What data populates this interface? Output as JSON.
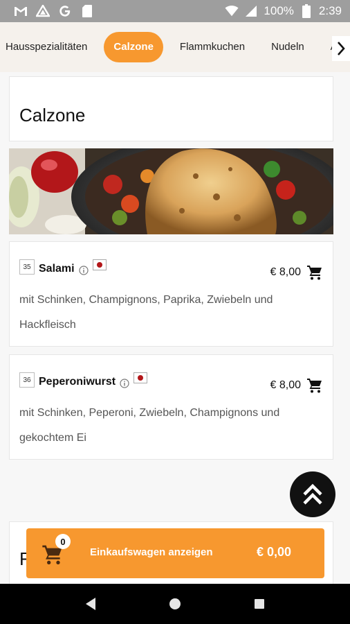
{
  "status_bar": {
    "battery": "100%",
    "time": "2:39"
  },
  "categories": {
    "items": [
      "Hausspezialitäten",
      "Calzone",
      "Flammkuchen",
      "Nudeln",
      "Al Forno"
    ],
    "active": "Calzone"
  },
  "section": {
    "title": "Calzone",
    "next_title_partial": "F"
  },
  "menu_items": [
    {
      "number": "35",
      "name": "Salami",
      "price": "€ 8,00",
      "description": "mit Schinken, Champignons, Paprika, Zwiebeln und Hackfleisch"
    },
    {
      "number": "36",
      "name": "Peperoniwurst",
      "price": "€ 8,00",
      "description": "mit Schinken, Peperoni, Zwiebeln, Champignons und gekochtem Ei"
    }
  ],
  "cart": {
    "count": "0",
    "label": "Einkaufswagen anzeigen",
    "total": "€ 0,00"
  },
  "colors": {
    "accent": "#f7982f",
    "status_bar": "#9e9e9e",
    "nav_bar": "#000000"
  },
  "icons": {
    "status_left": [
      "gmail-icon",
      "drive-icon",
      "google-icon",
      "sd-card-icon"
    ],
    "status_right": [
      "wifi-icon",
      "signal-icon",
      "battery-icon"
    ],
    "nav": [
      "back-icon",
      "home-icon",
      "recents-icon"
    ]
  }
}
